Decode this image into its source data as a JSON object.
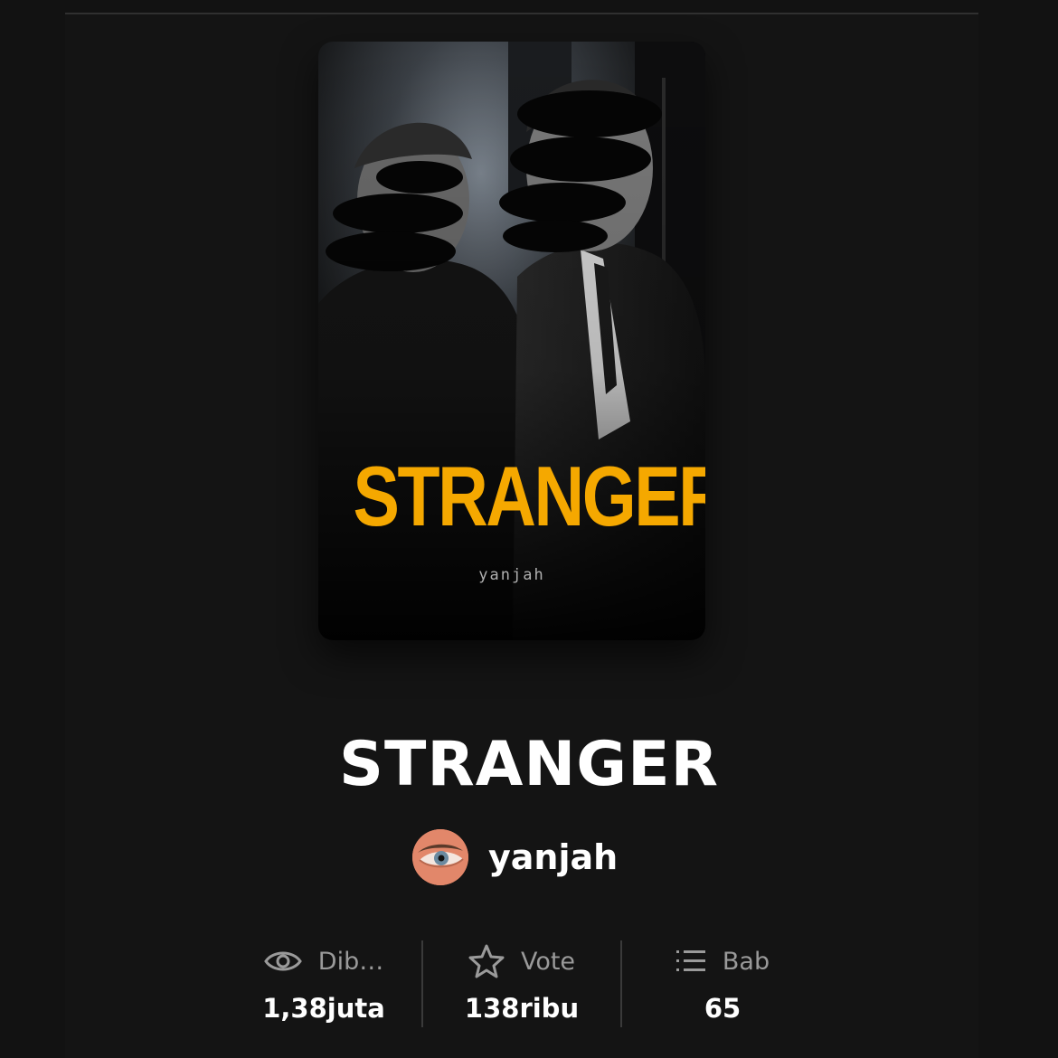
{
  "story": {
    "title": "STRANGER",
    "cover": {
      "title_text": "STRANGER",
      "author_text": "yanjah",
      "accent_color": "#f5a800"
    },
    "author": {
      "name": "yanjah",
      "avatar_icon": "eye-avatar"
    }
  },
  "stats": [
    {
      "icon": "eye-icon",
      "label": "Dib…",
      "value": "1,38juta"
    },
    {
      "icon": "star-icon",
      "label": "Vote",
      "value": "138ribu"
    },
    {
      "icon": "list-icon",
      "label": "Bab",
      "value": "65"
    }
  ],
  "colors": {
    "background": "#121212",
    "text_primary": "#ffffff",
    "text_secondary": "#9a9a9a"
  }
}
